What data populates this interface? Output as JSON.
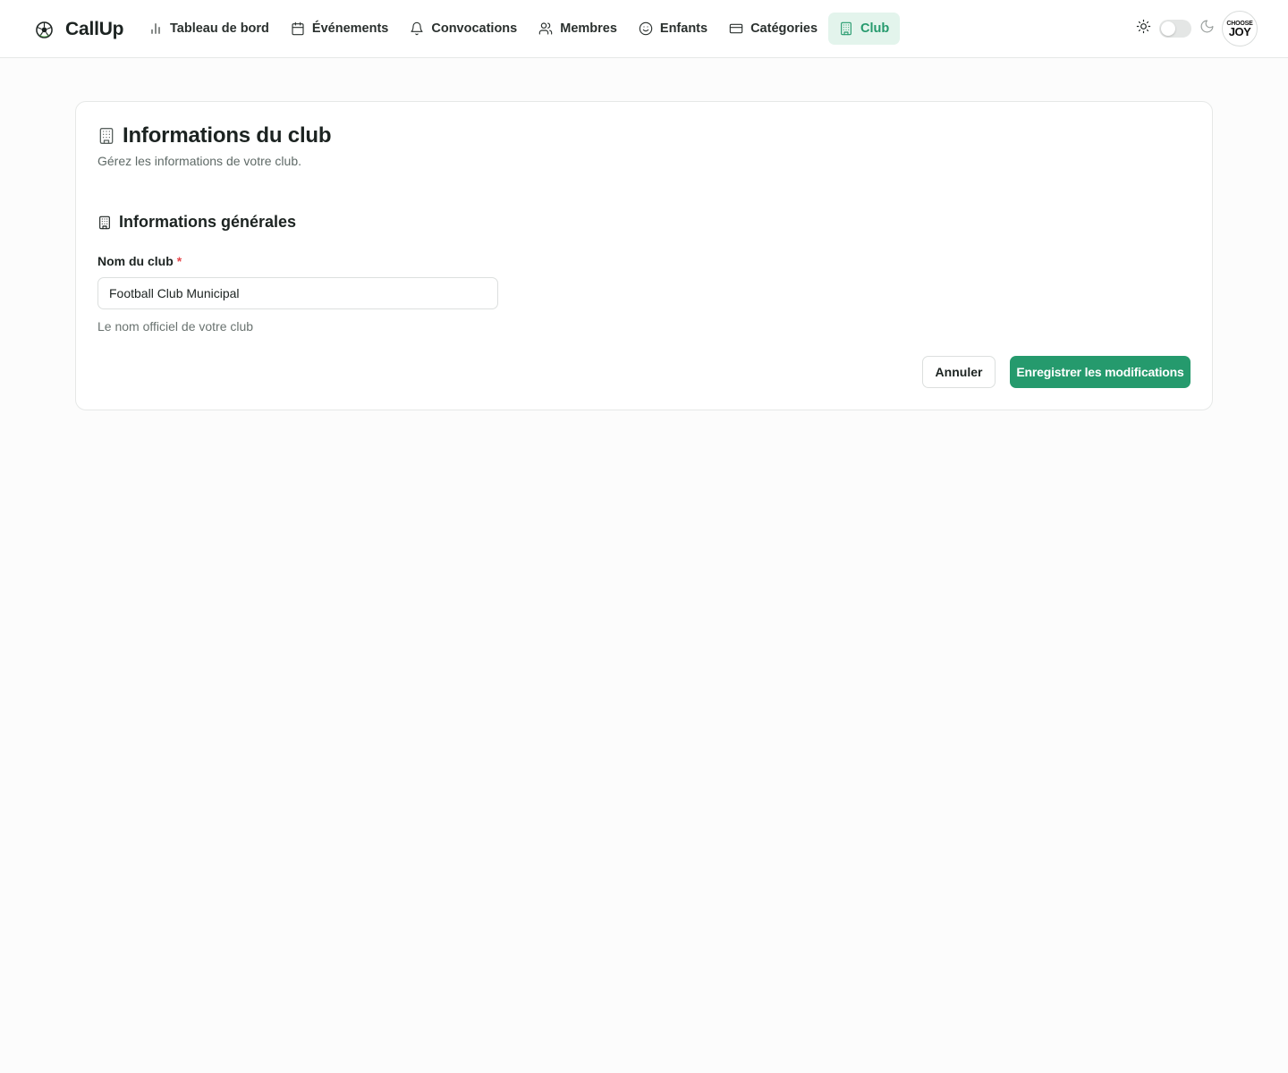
{
  "app": {
    "name": "CallUp",
    "logo_icon": "soccer-ball-icon"
  },
  "nav": {
    "items": [
      {
        "label": "Tableau de bord",
        "icon": "bar-chart-icon"
      },
      {
        "label": "Événements",
        "icon": "calendar-icon"
      },
      {
        "label": "Convocations",
        "icon": "bell-icon"
      },
      {
        "label": "Membres",
        "icon": "users-icon"
      },
      {
        "label": "Enfants",
        "icon": "smile-icon"
      },
      {
        "label": "Catégories",
        "icon": "credit-card-icon"
      },
      {
        "label": "Club",
        "icon": "building-icon",
        "active": true
      }
    ]
  },
  "theme": {
    "mode": "light",
    "light_icon": "sun-icon",
    "dark_icon": "moon-icon"
  },
  "avatar": {
    "line1": "CHOOSE",
    "line2": "JOY"
  },
  "page": {
    "title": "Informations du club",
    "subtitle": "Gérez les informations de votre club.",
    "title_icon": "building-icon"
  },
  "section": {
    "title": "Informations générales",
    "icon": "building-icon"
  },
  "form": {
    "club_name": {
      "label": "Nom du club",
      "required_mark": "*",
      "value": "Football Club Municipal",
      "helper": "Le nom officiel de votre club"
    },
    "cancel_label": "Annuler",
    "save_label": "Enregistrer les modifications"
  },
  "colors": {
    "accent": "#259a6d",
    "active_nav_bg": "#e3f4ec",
    "required": "#e5484d"
  }
}
